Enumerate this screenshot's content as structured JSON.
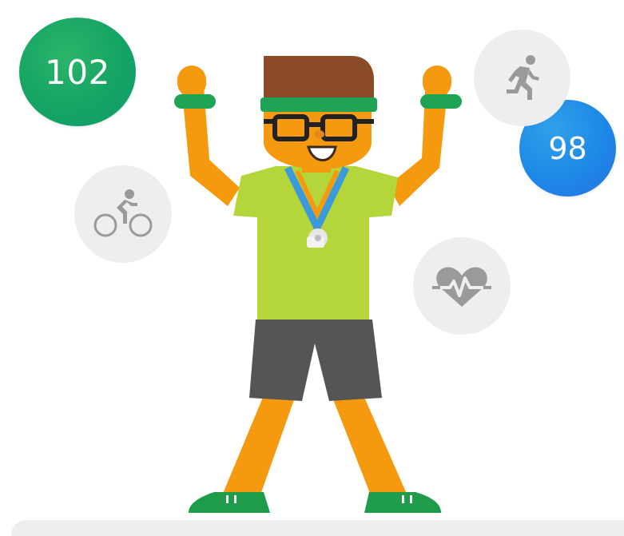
{
  "scores": {
    "left": "102",
    "right": "98"
  },
  "activities": [
    {
      "name": "running",
      "icon": "running-icon"
    },
    {
      "name": "cycling",
      "icon": "cycling-icon"
    },
    {
      "name": "heart-rate",
      "icon": "heart-rate-icon"
    }
  ],
  "colors": {
    "score_left": "#14a463",
    "score_right": "#1d86e6",
    "icon_circle": "#eeeeee",
    "icon_glyph": "#9a9a9a",
    "skin": "#f5a623",
    "shirt": "#b5d63a",
    "shorts": "#555555",
    "headband": "#1fa456",
    "hair": "#8b4a28",
    "shoes": "#1f9c4a",
    "lanyard": "#3d9ad9"
  }
}
